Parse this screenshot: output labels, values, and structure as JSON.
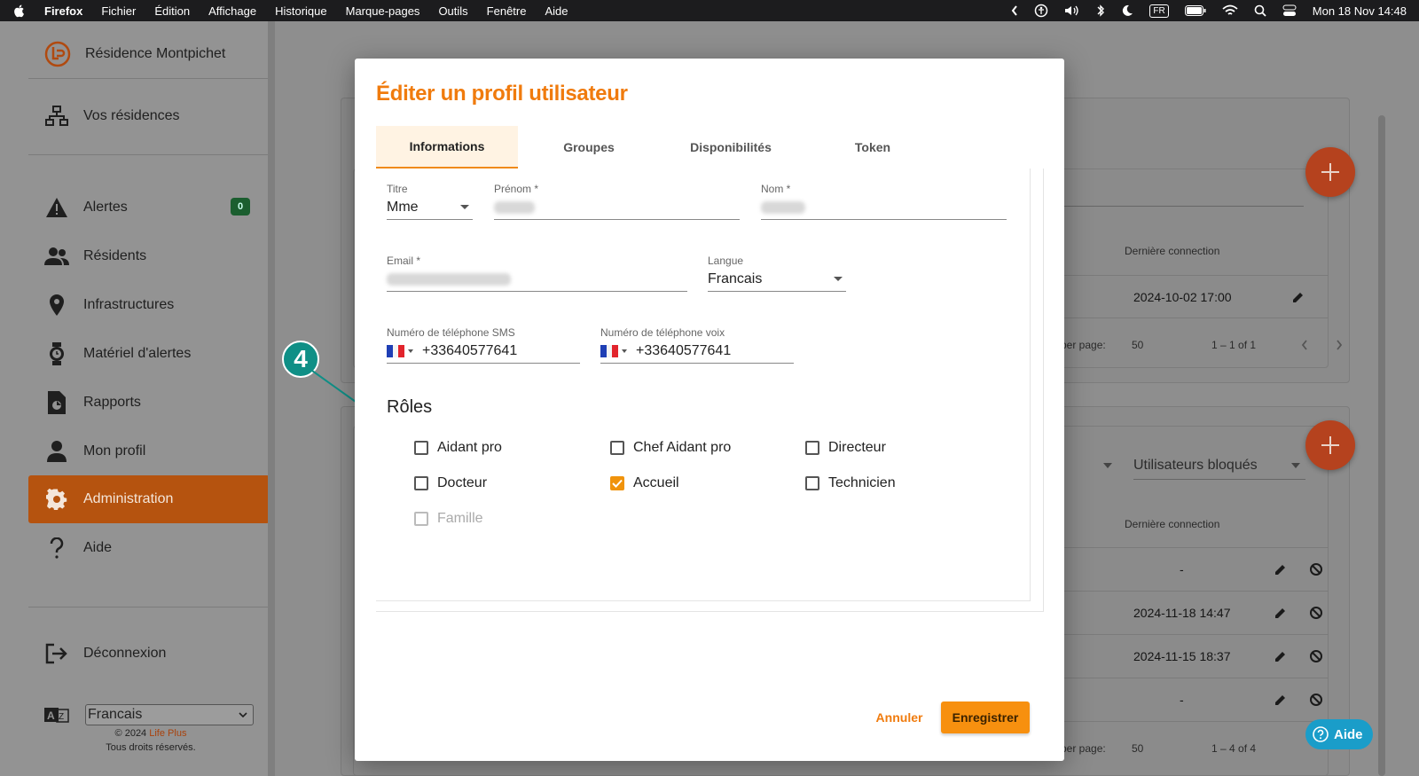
{
  "menubar": {
    "items": [
      "Firefox",
      "Fichier",
      "Édition",
      "Affichage",
      "Historique",
      "Marque-pages",
      "Outils",
      "Fenêtre",
      "Aide"
    ],
    "keyboard": "FR",
    "clock": "Mon 18 Nov  14:48"
  },
  "sidebar": {
    "residence": "Résidence Montpichet",
    "residences_link": "Vos résidences",
    "items": [
      {
        "label": "Alertes",
        "icon": "warning-icon"
      },
      {
        "label": "Résidents",
        "icon": "people-icon"
      },
      {
        "label": "Infrastructures",
        "icon": "location-pin-icon"
      },
      {
        "label": "Matériel d'alertes",
        "icon": "watch-icon"
      },
      {
        "label": "Rapports",
        "icon": "report-icon"
      },
      {
        "label": "Mon profil",
        "icon": "person-icon"
      },
      {
        "label": "Administration",
        "icon": "gear-icon"
      },
      {
        "label": "Aide",
        "icon": "question-icon"
      }
    ],
    "alert_count": "0",
    "logout": "Déconnexion",
    "language": "Francais",
    "copyright_prefix": "© 2024 ",
    "copyright_brand": "Life Plus",
    "rights": "Tous droits réservés."
  },
  "background": {
    "col_last_connection": "Dernière connection",
    "table1": {
      "row_date": "2024-10-02 17:00",
      "items_per_page_label": "ns per page:",
      "items_per_page": "50",
      "range": "1 – 1 of 1"
    },
    "blocked_users": "Utilisateurs bloqués",
    "table2": {
      "rows": [
        "-",
        "2024-11-18 14:47",
        "2024-11-15 18:37",
        "-"
      ],
      "items_per_page_label": "ns per page:",
      "items_per_page": "50",
      "range": "1 – 4 of 4"
    },
    "help_label": "Aide"
  },
  "dialog": {
    "title": "Éditer un profil utilisateur",
    "tabs": [
      "Informations",
      "Groupes",
      "Disponibilités",
      "Token"
    ],
    "active_tab": "Informations",
    "fields": {
      "title_label": "Titre",
      "title_value": "Mme",
      "firstname_label": "Prénom *",
      "lastname_label": "Nom *",
      "email_label": "Email *",
      "language_label": "Langue",
      "language_value": "Francais",
      "sms_label": "Numéro de téléphone SMS",
      "sms_value": "+33640577641",
      "voice_label": "Numéro de téléphone voix",
      "voice_value": "+33640577641"
    },
    "roles_title": "Rôles",
    "roles": [
      {
        "label": "Aidant pro",
        "checked": false
      },
      {
        "label": "Chef Aidant pro",
        "checked": false
      },
      {
        "label": "Directeur",
        "checked": false
      },
      {
        "label": "Docteur",
        "checked": false
      },
      {
        "label": "Accueil",
        "checked": true
      },
      {
        "label": "Technicien",
        "checked": false
      },
      {
        "label": "Famille",
        "checked": false,
        "disabled": true
      }
    ],
    "cancel": "Annuler",
    "save": "Enregistrer"
  },
  "annotation": {
    "step": "4"
  },
  "colors": {
    "accent": "#f07b0d",
    "save": "#f7900f",
    "callout": "#0f8f86",
    "checkbox": "#f0930c"
  }
}
